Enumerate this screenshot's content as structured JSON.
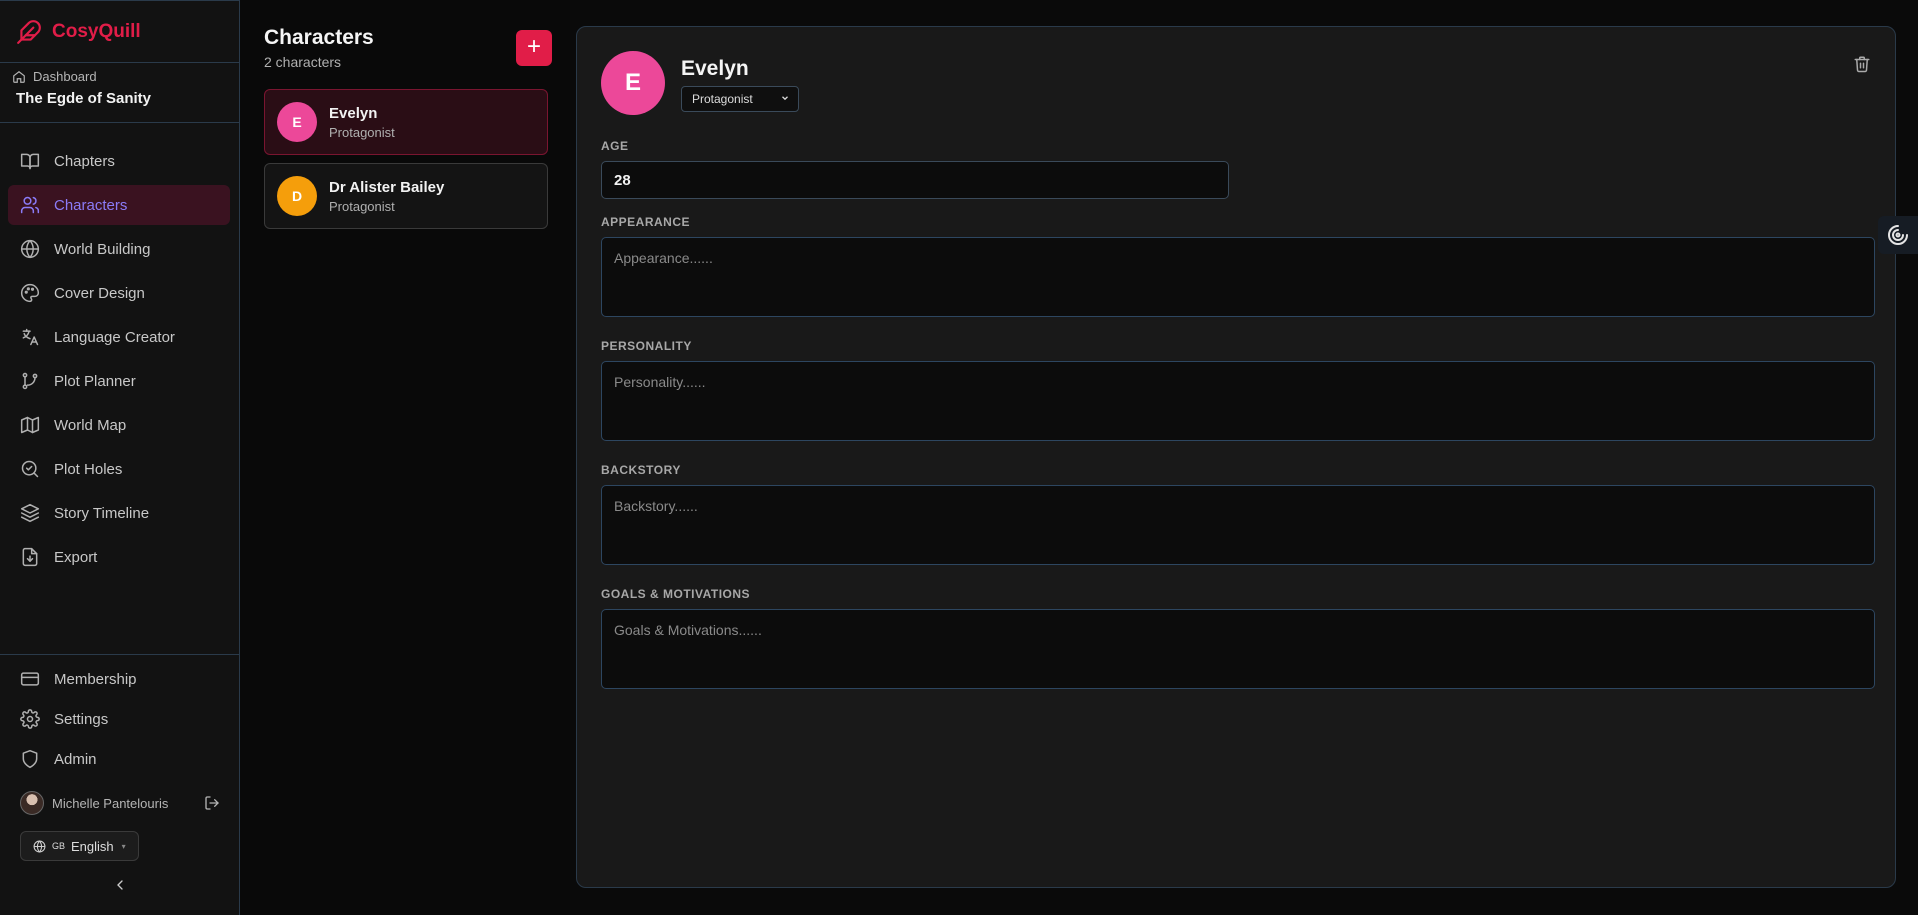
{
  "brand": {
    "name": "CosyQuill",
    "color": "#e11d48"
  },
  "project": {
    "dashboard_label": "Dashboard",
    "title": "The Egde of Sanity"
  },
  "nav": {
    "items": [
      {
        "label": "Chapters",
        "icon": "book-open-icon"
      },
      {
        "label": "Characters",
        "icon": "users-icon",
        "active": true
      },
      {
        "label": "World Building",
        "icon": "globe-icon"
      },
      {
        "label": "Cover Design",
        "icon": "palette-icon"
      },
      {
        "label": "Language Creator",
        "icon": "translate-icon"
      },
      {
        "label": "Plot Planner",
        "icon": "git-branch-icon"
      },
      {
        "label": "World Map",
        "icon": "map-icon"
      },
      {
        "label": "Plot Holes",
        "icon": "search-check-icon"
      },
      {
        "label": "Story Timeline",
        "icon": "layers-icon"
      },
      {
        "label": "Export",
        "icon": "file-export-icon"
      }
    ],
    "bottom": [
      {
        "label": "Membership",
        "icon": "credit-card-icon"
      },
      {
        "label": "Settings",
        "icon": "gear-icon"
      },
      {
        "label": "Admin",
        "icon": "shield-icon"
      }
    ]
  },
  "user": {
    "name": "Michelle Pantelouris"
  },
  "language": {
    "flag": "GB",
    "label": "English"
  },
  "characters_panel": {
    "title": "Characters",
    "count": "2 characters",
    "add_label": "+",
    "list": [
      {
        "initial": "E",
        "name": "Evelyn",
        "role": "Protagonist",
        "color": "#ec4899",
        "selected": true
      },
      {
        "initial": "D",
        "name": "Dr Alister Bailey",
        "role": "Protagonist",
        "color": "#f59e0b",
        "selected": false
      }
    ]
  },
  "detail": {
    "initial": "E",
    "name": "Evelyn",
    "role_selected": "Protagonist",
    "age_label": "AGE",
    "age_value": "28",
    "appearance_label": "APPEARANCE",
    "appearance_placeholder": "Appearance......",
    "personality_label": "PERSONALITY",
    "personality_placeholder": "Personality......",
    "backstory_label": "BACKSTORY",
    "backstory_placeholder": "Backstory......",
    "goals_label": "GOALS & MOTIVATIONS",
    "goals_placeholder": "Goals & Motivations......"
  }
}
